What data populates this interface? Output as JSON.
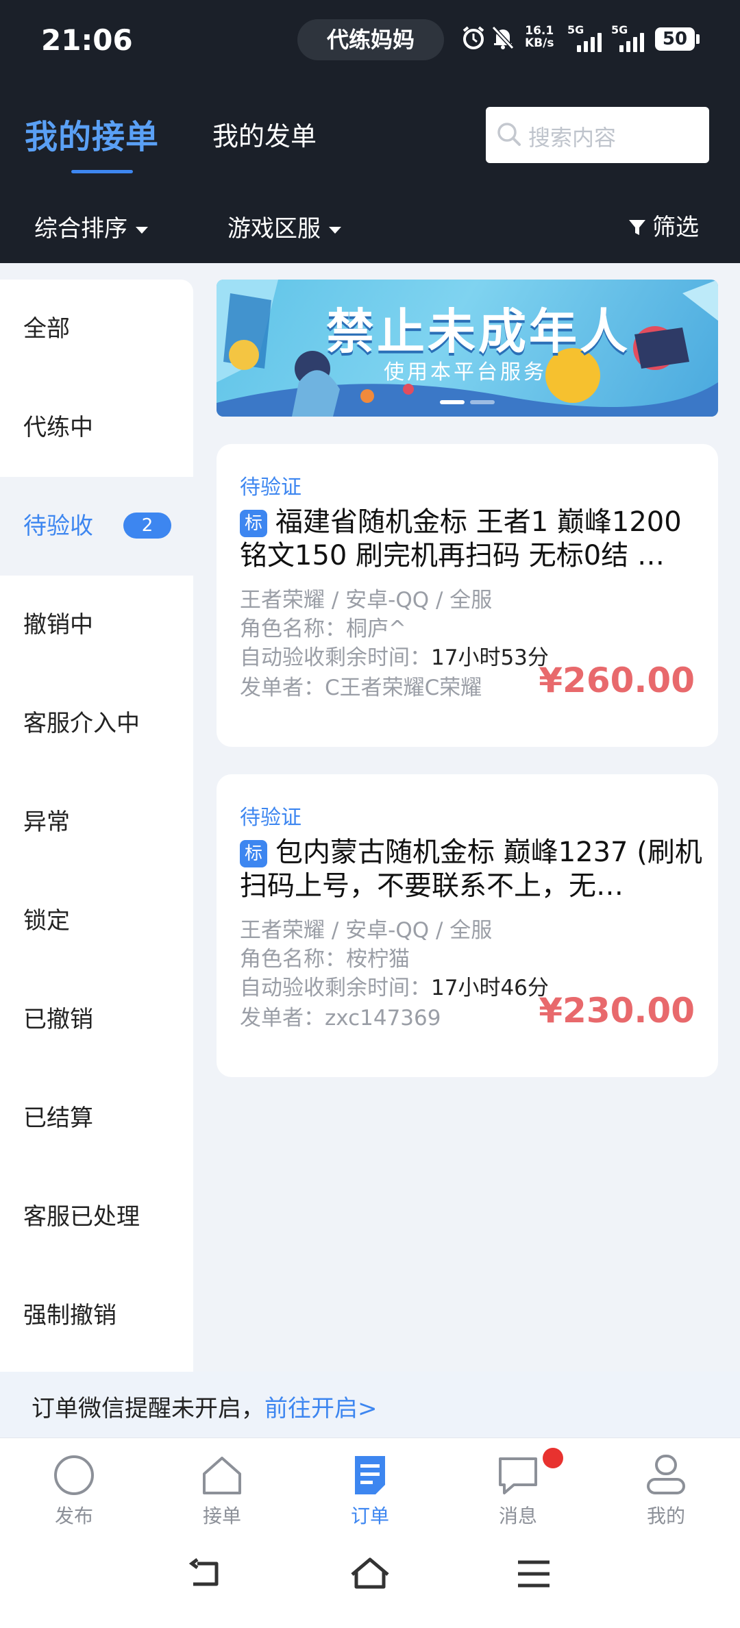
{
  "status_bar": {
    "time": "21:06",
    "app_pill": "代练妈妈",
    "net_speed_value": "16.1",
    "net_speed_unit": "KB/s",
    "sim1": "5G",
    "sim2": "5G",
    "battery": "50",
    "icons": [
      "alarm-icon",
      "bell-muted-icon",
      "signal-icon",
      "battery-icon"
    ]
  },
  "header": {
    "tabs": [
      {
        "label": "我的接单",
        "active": true
      },
      {
        "label": "我的发单",
        "active": false
      }
    ],
    "search_placeholder": "搜索内容",
    "sort_label": "综合排序",
    "region_label": "游戏区服",
    "filter_label": "筛选"
  },
  "sidebar": {
    "items": [
      {
        "label": "全部"
      },
      {
        "label": "代练中"
      },
      {
        "label": "待验收",
        "badge": "2",
        "active": true
      },
      {
        "label": "撤销中"
      },
      {
        "label": "客服介入中"
      },
      {
        "label": "异常"
      },
      {
        "label": "锁定"
      },
      {
        "label": "已撤销"
      },
      {
        "label": "已结算"
      },
      {
        "label": "客服已处理"
      },
      {
        "label": "强制撤销"
      }
    ]
  },
  "banner": {
    "title": "禁止未成年人",
    "subtitle": "使用本平台服务"
  },
  "orders": [
    {
      "status": "待验证",
      "tag": "标",
      "title": "福建省随机金标 王者1 巅峰1200 铭文150 刷完机再扫码 无标0结 …",
      "game": "王者荣耀 / 安卓-QQ / 全服",
      "role_label": "角色名称：",
      "role": "桐庐^",
      "timer_label": "自动验收剩余时间：",
      "timer": "17小时53分",
      "publisher_label": "发单者：",
      "publisher": "C王者荣耀C荣耀",
      "price": "¥260.00"
    },
    {
      "status": "待验证",
      "tag": "标",
      "title": "包内蒙古随机金标 巅峰1237 (刷机扫码上号，不要联系不上，无…",
      "game": "王者荣耀 / 安卓-QQ / 全服",
      "role_label": "角色名称：",
      "role": "桉柠猫",
      "timer_label": "自动验收剩余时间：",
      "timer": "17小时46分",
      "publisher_label": "发单者：",
      "publisher": "zxc147369",
      "price": "¥230.00"
    }
  ],
  "notice": {
    "text": "订单微信提醒未开启，",
    "link": "前往开启>"
  },
  "bottom_nav": [
    {
      "label": "发布",
      "icon": "circle-icon"
    },
    {
      "label": "接单",
      "icon": "home-icon"
    },
    {
      "label": "订单",
      "icon": "order-icon",
      "active": true
    },
    {
      "label": "消息",
      "icon": "message-icon",
      "has_dot": true
    },
    {
      "label": "我的",
      "icon": "user-icon"
    }
  ],
  "colors": {
    "accent": "#3d86f0",
    "header_bg": "#1b2029",
    "price": "#e8696c",
    "page_bg": "#f0f3f8"
  }
}
